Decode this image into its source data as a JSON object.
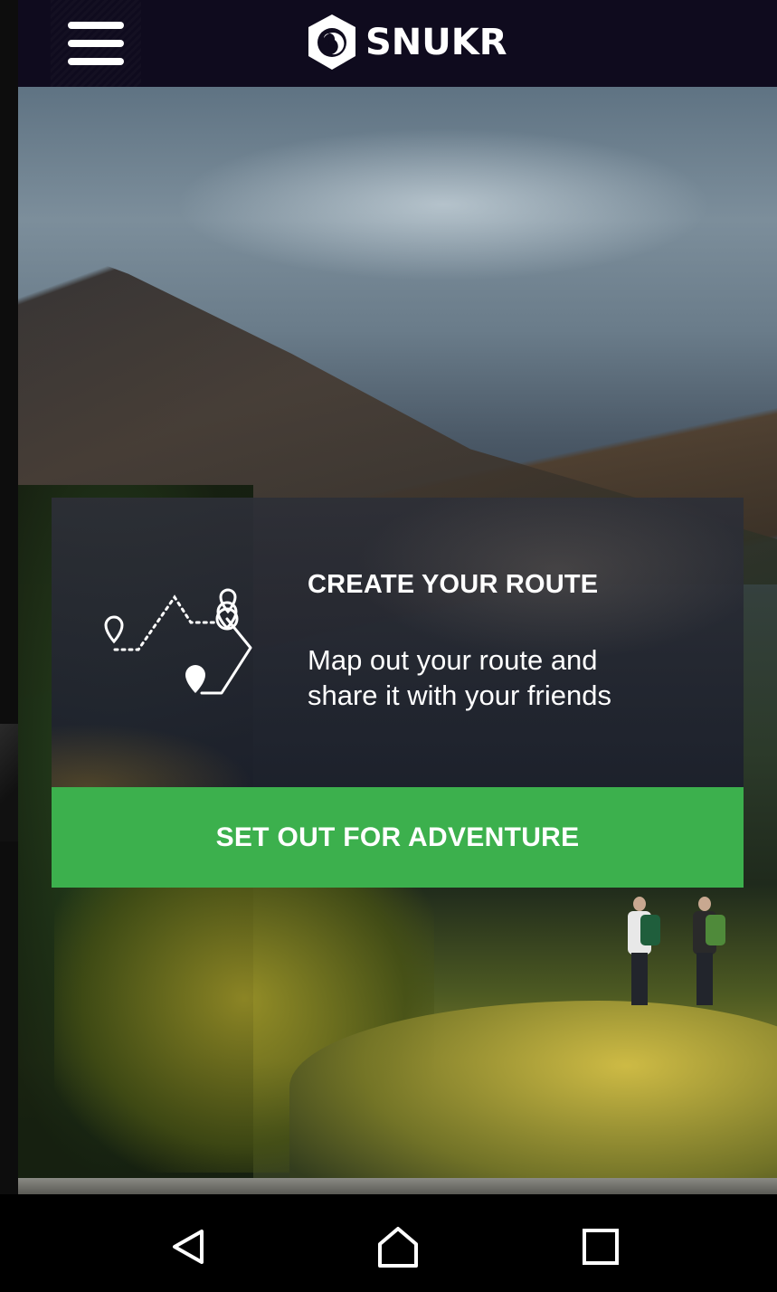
{
  "app": {
    "brand": "SNUKR"
  },
  "header": {
    "menu_icon": "hamburger-menu-icon",
    "logo_icon": "snukr-logo-icon"
  },
  "card": {
    "icon": "route-map-icon",
    "title": "CREATE YOUR ROUTE",
    "text_line1": "Map out your route and",
    "text_line2": "share it with your friends"
  },
  "cta": {
    "label": "SET OUT FOR ADVENTURE",
    "color": "#3cb04d"
  },
  "system_nav": {
    "back_icon": "back-triangle-icon",
    "home_icon": "home-icon",
    "recents_icon": "recents-square-icon"
  },
  "colors": {
    "app_bar": "#0f0b1e",
    "nav_bar": "#000000",
    "accent": "#3cb04d"
  }
}
